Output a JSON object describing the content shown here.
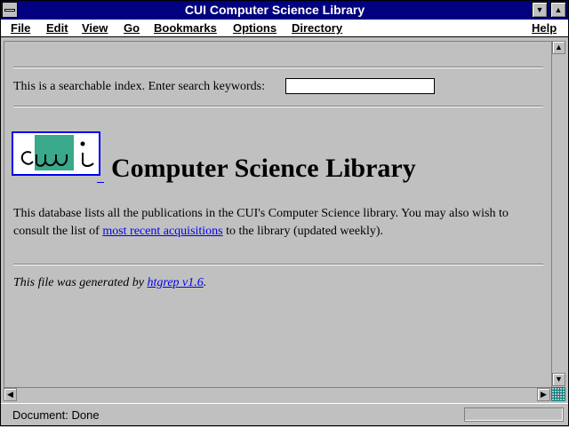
{
  "window": {
    "title": "CUI Computer Science Library"
  },
  "menu": {
    "file": "File",
    "edit": "Edit",
    "view": "View",
    "go": "Go",
    "bookmarks": "Bookmarks",
    "options": "Options",
    "directory": "Directory",
    "help": "Help"
  },
  "search": {
    "prompt": "This is a searchable index. Enter search keywords:",
    "value": ""
  },
  "logo": {
    "alt": "cui"
  },
  "page": {
    "heading": "Computer Science Library",
    "para_text_1": "This database lists all the publications in the CUI's Computer Science library. You may also wish to consult the list of ",
    "para_link": "most recent acquisitions",
    "para_text_2": " to the library (updated weekly).",
    "footer_text": "This file was generated by ",
    "footer_link": "htgrep v1.6",
    "footer_end": "."
  },
  "status": {
    "text": "Document: Done"
  },
  "icons": {
    "system_menu": "system-menu-icon",
    "minimize": "minimize-icon",
    "maximize": "maximize-icon",
    "scroll_up": "arrow-up-icon",
    "scroll_down": "arrow-down-icon",
    "scroll_left": "arrow-left-icon",
    "scroll_right": "arrow-right-icon"
  },
  "colors": {
    "title_bar": "#000080",
    "link": "#0000ee",
    "logo_teal": "#3aa88a"
  }
}
